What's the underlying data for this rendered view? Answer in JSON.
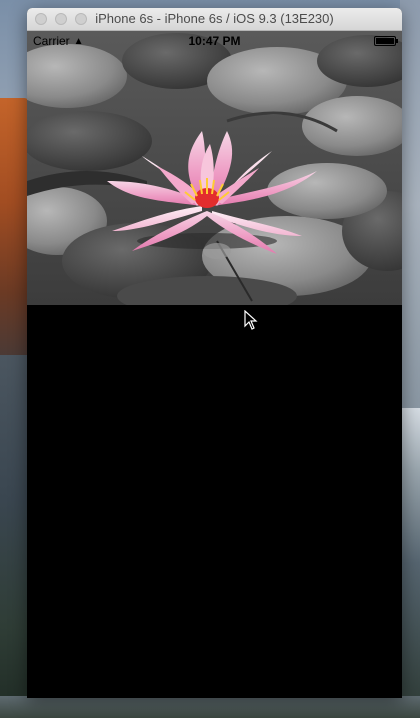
{
  "window": {
    "title": "iPhone 6s - iPhone 6s / iOS 9.3 (13E230)"
  },
  "status_bar": {
    "carrier": "Carrier",
    "time": "10:47 PM"
  },
  "content": {
    "image_subject": "pink water lily on lily pads"
  },
  "icons": {
    "wifi": "wifi-icon",
    "battery": "battery-icon",
    "cursor": "mouse-pointer-icon"
  }
}
